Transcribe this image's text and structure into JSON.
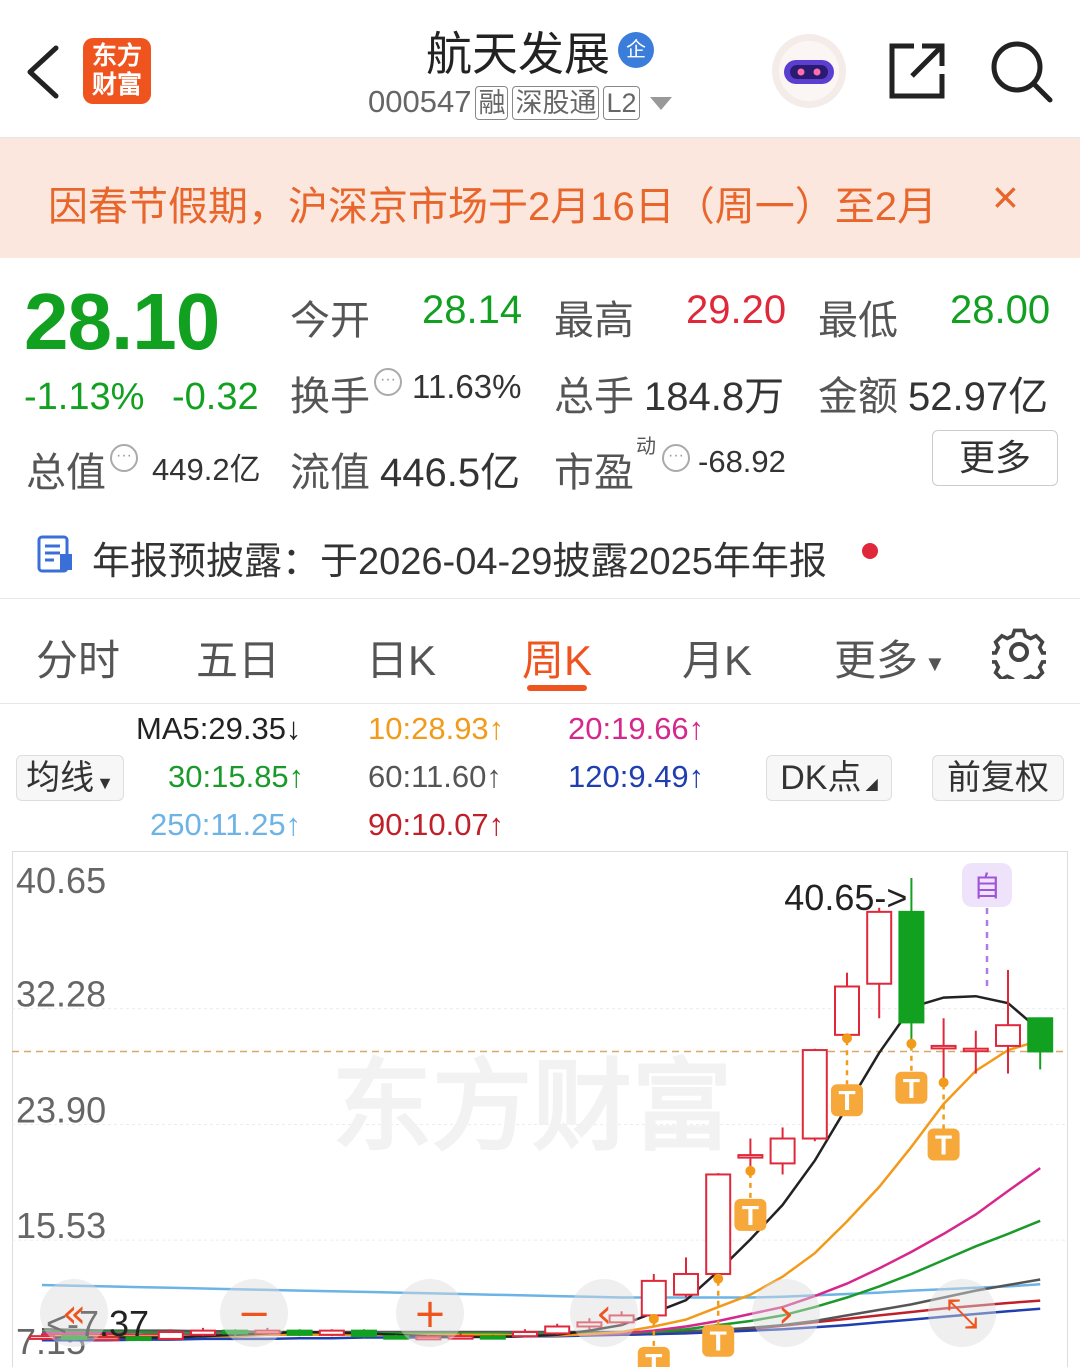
{
  "header": {
    "back_icon": "chevron-left-icon",
    "logo_line1": "东方",
    "logo_line2": "财富",
    "stock_name": "航天发展",
    "qi_badge": "企",
    "stock_code": "000547",
    "tags": [
      "融",
      "深股通",
      "L2"
    ],
    "share_icon": "share-icon",
    "search_icon": "search-icon",
    "assistant_icon": "robot-assistant-icon"
  },
  "banner": {
    "text": "因春节假期，沪深京市场于2月16日（周一）至2月",
    "close": "×"
  },
  "quote": {
    "price": "28.10",
    "change_pct": "-1.13%",
    "change": "-0.32",
    "open_label": "今开",
    "open": "28.14",
    "high_label": "最高",
    "high": "29.20",
    "low_label": "最低",
    "low": "28.00",
    "turnover_label": "换手",
    "turnover": "11.63%",
    "volume_label": "总手",
    "volume": "184.8万",
    "amount_label": "金额",
    "amount": "52.97亿",
    "mcap_label": "总值",
    "mcap": "449.2亿",
    "float_label": "流值",
    "float": "446.5亿",
    "pe_label": "市盈",
    "pe_sup": "动",
    "pe": "-68.92",
    "more": "更多"
  },
  "announcement": {
    "icon": "report-icon",
    "text": "年报预披露：于2026-04-29披露2025年年报"
  },
  "tabs": [
    "分时",
    "五日",
    "日K",
    "周K",
    "月K",
    "更多"
  ],
  "active_tab": "周K",
  "settings_icon": "gear-icon",
  "ma": {
    "ma5": "MA5:29.35↓",
    "ma10": "10:28.93↑",
    "ma20": "20:19.66↑",
    "ma30": "30:15.85↑",
    "ma60": "60:11.60↑",
    "ma120": "120:9.49↑",
    "ma250": "250:11.25↑",
    "ma90": "90:10.07↑",
    "selector": "均线",
    "dk": "DK点",
    "adjust": "前复权"
  },
  "colors": {
    "up": "#e0283a",
    "down": "#12a021",
    "accent": "#f0541e",
    "ma5": "#222222",
    "ma10": "#f29a1a",
    "ma20": "#d6288c",
    "ma30": "#1a9a2a",
    "ma60": "#555555",
    "ma120": "#1f3fb0",
    "ma250": "#6cb3e6",
    "ma90": "#c0202a"
  },
  "chart_data": {
    "type": "candlestick",
    "period": "weekly",
    "y_ticks": [
      "40.65",
      "32.28",
      "23.90",
      "15.53",
      "7.15"
    ],
    "ylim": [
      7.15,
      40.65
    ],
    "current_price": 28.1,
    "high_label": "40.65->",
    "low_label": "<-7.37",
    "high_value": 40.65,
    "low_value": 7.37,
    "self_marker": "自",
    "t_marker": "T",
    "watermark": "东方财富",
    "candles": [
      {
        "o": 7.3,
        "c": 7.5,
        "h": 7.7,
        "l": 7.2
      },
      {
        "o": 7.5,
        "c": 7.3,
        "h": 7.6,
        "l": 7.2
      },
      {
        "o": 7.3,
        "c": 7.4,
        "h": 7.6,
        "l": 7.2
      },
      {
        "o": 7.4,
        "c": 7.3,
        "h": 7.5,
        "l": 7.2
      },
      {
        "o": 7.3,
        "c": 7.8,
        "h": 8.0,
        "l": 7.2
      },
      {
        "o": 7.6,
        "c": 7.9,
        "h": 8.1,
        "l": 7.5
      },
      {
        "o": 7.9,
        "c": 7.7,
        "h": 8.0,
        "l": 7.5
      },
      {
        "o": 7.7,
        "c": 7.9,
        "h": 8.1,
        "l": 7.6
      },
      {
        "o": 7.9,
        "c": 7.6,
        "h": 8.0,
        "l": 7.5
      },
      {
        "o": 7.6,
        "c": 7.9,
        "h": 8.0,
        "l": 7.5
      },
      {
        "o": 7.9,
        "c": 7.5,
        "h": 8.0,
        "l": 7.4
      },
      {
        "o": 7.5,
        "c": 7.4,
        "h": 7.6,
        "l": 7.3
      },
      {
        "o": 7.4,
        "c": 7.45,
        "h": 7.6,
        "l": 7.35
      },
      {
        "o": 7.4,
        "c": 7.5,
        "h": 7.7,
        "l": 7.37
      },
      {
        "o": 7.5,
        "c": 7.45,
        "h": 7.6,
        "l": 7.4
      },
      {
        "o": 7.5,
        "c": 7.8,
        "h": 8.0,
        "l": 7.4
      },
      {
        "o": 7.7,
        "c": 8.2,
        "h": 8.4,
        "l": 7.6
      },
      {
        "o": 8.2,
        "c": 8.5,
        "h": 8.8,
        "l": 8.0
      },
      {
        "o": 8.5,
        "c": 9.0,
        "h": 9.3,
        "l": 8.3
      },
      {
        "o": 9.0,
        "c": 11.5,
        "h": 12.0,
        "l": 8.9
      },
      {
        "o": 10.5,
        "c": 12.0,
        "h": 13.2,
        "l": 10.3
      },
      {
        "o": 12.0,
        "c": 19.2,
        "h": 19.3,
        "l": 11.8
      },
      {
        "o": 20.6,
        "c": 20.6,
        "h": 21.8,
        "l": 19.6
      },
      {
        "o": 20.0,
        "c": 21.8,
        "h": 22.6,
        "l": 19.2
      },
      {
        "o": 21.8,
        "c": 28.2,
        "h": 28.3,
        "l": 21.6
      },
      {
        "o": 29.3,
        "c": 32.8,
        "h": 33.8,
        "l": 29.2
      },
      {
        "o": 33.0,
        "c": 38.2,
        "h": 38.5,
        "l": 30.5
      },
      {
        "o": 38.2,
        "c": 30.2,
        "h": 40.65,
        "l": 28.8
      },
      {
        "o": 28.5,
        "c": 28.5,
        "h": 30.5,
        "l": 26.0
      },
      {
        "o": 28.3,
        "c": 28.3,
        "h": 29.6,
        "l": 26.5
      },
      {
        "o": 28.5,
        "c": 30.0,
        "h": 34.0,
        "l": 26.5
      },
      {
        "o": 30.5,
        "c": 28.1,
        "h": 30.5,
        "l": 26.8
      }
    ],
    "ma5": [
      7.4,
      7.4,
      7.4,
      7.4,
      7.4,
      7.5,
      7.6,
      7.7,
      7.8,
      7.75,
      7.7,
      7.6,
      7.5,
      7.45,
      7.45,
      7.5,
      7.6,
      7.9,
      8.3,
      9.2,
      10.1,
      12.2,
      14.5,
      17.0,
      20.2,
      24.1,
      28.0,
      31.3,
      32.0,
      32.1,
      31.6,
      29.6
    ],
    "ma10": [
      7.5,
      7.5,
      7.5,
      7.5,
      7.5,
      7.5,
      7.5,
      7.6,
      7.6,
      7.6,
      7.6,
      7.6,
      7.6,
      7.6,
      7.6,
      7.55,
      7.55,
      7.65,
      7.8,
      8.2,
      8.7,
      9.6,
      10.5,
      11.8,
      13.5,
      15.8,
      18.3,
      21.2,
      24.3,
      26.7,
      28.2,
      28.9
    ],
    "ma20": [
      7.7,
      7.7,
      7.7,
      7.6,
      7.6,
      7.6,
      7.6,
      7.6,
      7.6,
      7.6,
      7.6,
      7.6,
      7.6,
      7.6,
      7.6,
      7.6,
      7.6,
      7.6,
      7.7,
      7.9,
      8.2,
      8.6,
      9.1,
      9.6,
      10.4,
      11.3,
      12.4,
      13.6,
      14.9,
      16.3,
      18.0,
      19.66
    ],
    "ma30": [
      7.8,
      7.8,
      7.8,
      7.8,
      7.7,
      7.7,
      7.7,
      7.7,
      7.7,
      7.7,
      7.7,
      7.7,
      7.7,
      7.7,
      7.7,
      7.7,
      7.7,
      7.7,
      7.7,
      7.8,
      8.0,
      8.3,
      8.6,
      9.0,
      9.6,
      10.3,
      11.1,
      12.0,
      13.0,
      14.0,
      14.9,
      15.85
    ],
    "ma60": [
      8.0,
      7.95,
      7.9,
      7.9,
      7.9,
      7.85,
      7.85,
      7.8,
      7.8,
      7.8,
      7.8,
      7.8,
      7.8,
      7.8,
      7.8,
      7.8,
      7.8,
      7.8,
      7.8,
      7.8,
      7.85,
      7.95,
      8.1,
      8.3,
      8.6,
      9.0,
      9.4,
      9.8,
      10.3,
      10.8,
      11.2,
      11.6
    ],
    "ma120": [
      7.2,
      7.2,
      7.2,
      7.25,
      7.25,
      7.3,
      7.3,
      7.3,
      7.35,
      7.35,
      7.4,
      7.4,
      7.4,
      7.45,
      7.45,
      7.5,
      7.5,
      7.55,
      7.6,
      7.65,
      7.7,
      7.8,
      7.9,
      8.0,
      8.15,
      8.3,
      8.5,
      8.7,
      8.9,
      9.1,
      9.3,
      9.49
    ],
    "ma250": [
      11.2,
      11.15,
      11.1,
      11.05,
      11.0,
      10.95,
      10.9,
      10.85,
      10.8,
      10.75,
      10.7,
      10.65,
      10.6,
      10.55,
      10.5,
      10.45,
      10.4,
      10.35,
      10.3,
      10.3,
      10.3,
      10.3,
      10.3,
      10.35,
      10.45,
      10.55,
      10.65,
      10.8,
      10.9,
      11.0,
      11.1,
      11.25
    ],
    "ma90": [
      7.6,
      7.6,
      7.6,
      7.6,
      7.6,
      7.6,
      7.6,
      7.6,
      7.6,
      7.6,
      7.6,
      7.6,
      7.6,
      7.6,
      7.6,
      7.6,
      7.6,
      7.6,
      7.6,
      7.65,
      7.75,
      7.9,
      8.05,
      8.25,
      8.5,
      8.75,
      9.0,
      9.25,
      9.5,
      9.7,
      9.9,
      10.07
    ],
    "t_markers": [
      19,
      21,
      22,
      25,
      27,
      28
    ]
  },
  "overlay_controls": [
    "«",
    "−",
    "+",
    "‹",
    "›",
    "⤡"
  ]
}
